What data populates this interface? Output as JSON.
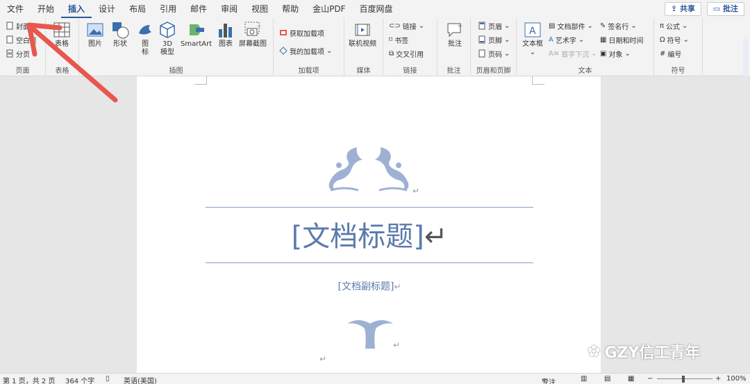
{
  "menu": {
    "tabs": [
      "文件",
      "开始",
      "插入",
      "设计",
      "布局",
      "引用",
      "邮件",
      "审阅",
      "视图",
      "帮助",
      "金山PDF",
      "百度网盘"
    ],
    "active": "插入",
    "share": "共享",
    "comment": "批注"
  },
  "ribbon": {
    "pages": {
      "label": "页面",
      "cover": "封面",
      "blank": "空白页",
      "break": "分页"
    },
    "tables": {
      "label": "表格",
      "table": "表格"
    },
    "illustrations": {
      "label": "插图",
      "picture": "图片",
      "shapes": "形状",
      "icons_1": "图",
      "icons_2": "标",
      "model_1": "3D",
      "model_2": "模型",
      "smartart": "SmartArt",
      "chart": "图表",
      "screenshot": "屏幕截图"
    },
    "addins": {
      "label": "加载项",
      "get": "获取加载项",
      "mine": "我的加载项"
    },
    "media": {
      "label": "媒体",
      "video": "联机视频"
    },
    "links": {
      "label": "链接",
      "link": "链接",
      "bookmark": "书签",
      "crossref": "交叉引用"
    },
    "comments": {
      "label": "批注",
      "comment": "批注"
    },
    "header_footer": {
      "label": "页眉和页脚",
      "header": "页眉",
      "footer": "页脚",
      "pagenum": "页码"
    },
    "text": {
      "label": "文本",
      "textbox": "文本框",
      "quickparts": "文档部件",
      "wordart": "艺术字",
      "dropcap": "首字下沉",
      "signature": "签名行",
      "datetime": "日期和时间",
      "object": "对象"
    },
    "symbols": {
      "label": "符号",
      "equation": "公式",
      "symbol": "符号",
      "number": "编号"
    }
  },
  "document": {
    "title": "[文档标题]",
    "subtitle": "[文档副标题]",
    "mark": "↵"
  },
  "status": {
    "page": "第 1 页，共 2 页",
    "words": "364 个字",
    "lang": "英语(美国)",
    "focus": "专注",
    "zoom": "100%"
  },
  "watermark": "GZY信工青年",
  "colors": {
    "accent": "#2b579a",
    "doc_blue": "#5b7aad",
    "arrow": "#e8574e"
  }
}
